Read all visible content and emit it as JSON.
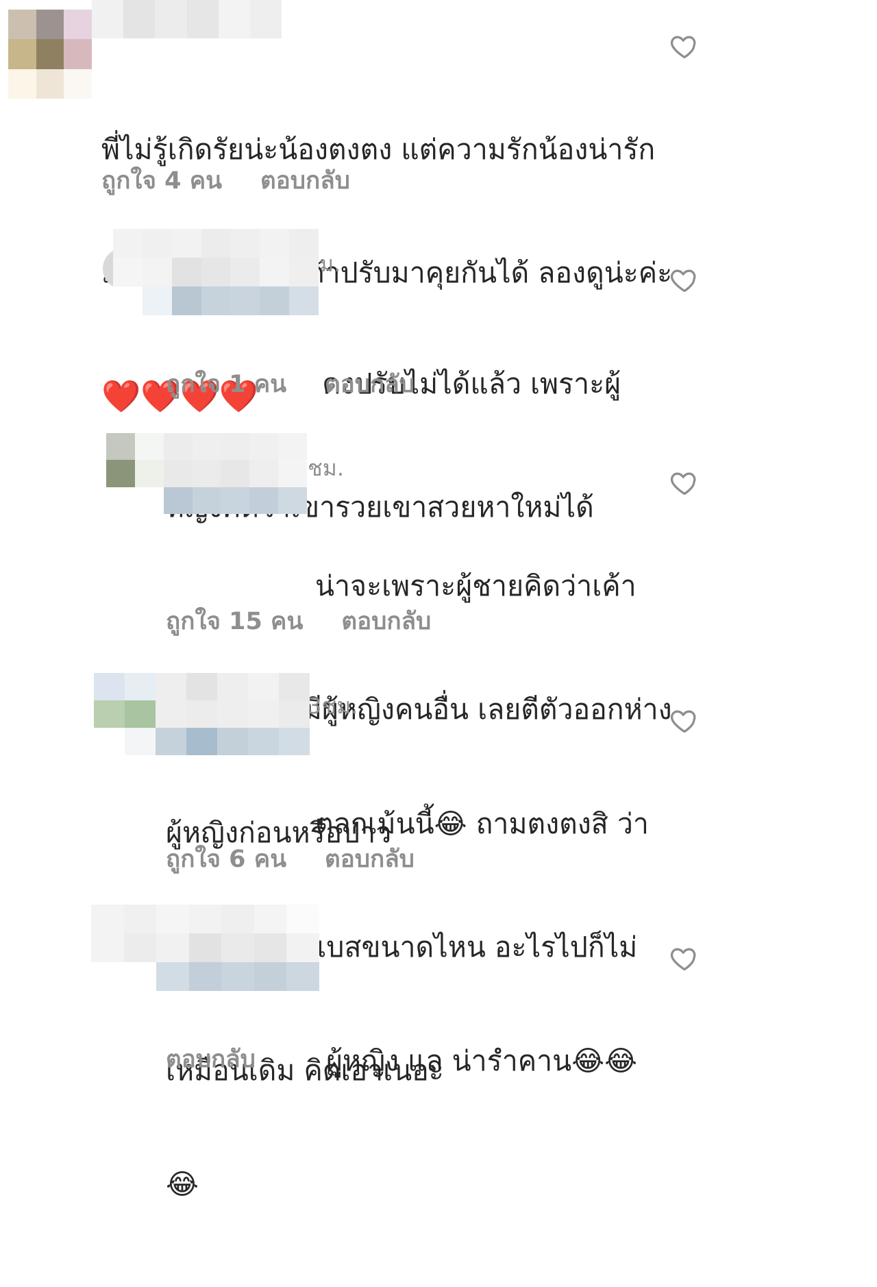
{
  "comments": [
    {
      "text_lines": [
        "พี่ไม่รู้เกิดรัยน่ะน้องตงตง แต่ความรักน้องน่ารัก",
        "มาก เสียดาย น่ะ ถ้าปรับมาคุยกันได้ ลองดูน่ะค่ะ"
      ],
      "emoji_line": "❤️❤️❤️❤️",
      "likes": "ถูกใจ 4 คน",
      "reply": "ตอบกลับ"
    },
    {
      "time": "ม.",
      "text_lines": [
        "คงปรับไม่ได้แล้ว เพราะผู้",
        "หญิงคิดว่าเขารวยเขาสวยหาใหม่ได้"
      ],
      "likes": "ถูกใจ 1 คน",
      "reply": "ตอบกลับ"
    },
    {
      "time": "ชม.",
      "text_lines": [
        "น่าจะเพราะผู้ชายคิดว่าเค้า",
        "หล่อเค้าดัง มีผู้หญิงคนอื่น เลยตีตัวออกห่าง",
        "ผู้หญิงก่อนหรือป่าว"
      ],
      "likes": "ถูกใจ 15 คน",
      "reply": "ตอบกลับ"
    },
    {
      "time": "3ชม.",
      "text_lines": [
        "ตลกเม้นนี้😂 ถามตงตงสิ ว่า",
        "ตีตัวออกห่างเบสขนาดไหน อะไรไปก็ไม่",
        "เหมือนเดิม คิดเอาเนอะ"
      ],
      "likes": "ถูกใจ 6 คน",
      "reply": "ตอบกลับ"
    },
    {
      "text_lines": [
        "ผู้หญิง แล น่ารำคาน😂😂",
        "😂"
      ],
      "reply": "ตอบกลับ"
    }
  ],
  "icons": {
    "like": "heart-outline-icon"
  },
  "colors": {
    "text": "#262626",
    "muted": "#8e8e8e",
    "heart_stroke": "#8e8e8e"
  }
}
